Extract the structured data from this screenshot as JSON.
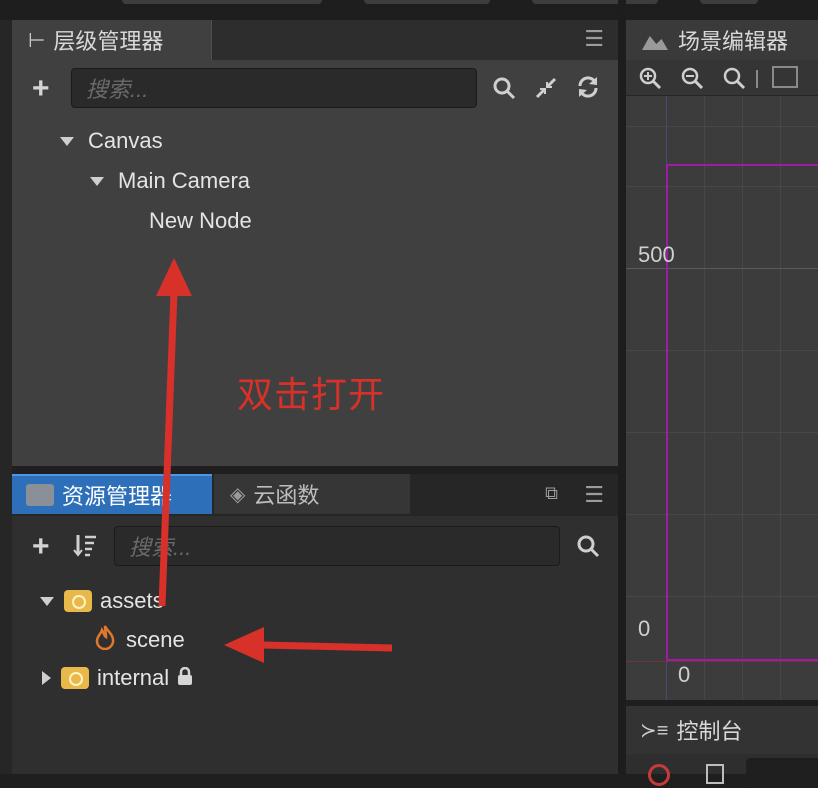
{
  "hierarchy": {
    "tab_label": "层级管理器",
    "search_placeholder": "搜索...",
    "tree": [
      {
        "label": "Canvas"
      },
      {
        "label": "Main Camera"
      },
      {
        "label": "New Node"
      }
    ]
  },
  "assets": {
    "tab_label": "资源管理器",
    "cloud_tab_label": "云函数",
    "search_placeholder": "搜索...",
    "tree": [
      {
        "label": "assets"
      },
      {
        "label": "scene"
      },
      {
        "label": "internal"
      }
    ]
  },
  "scene_editor": {
    "tab_label": "场景编辑器",
    "axis_labels": {
      "y_500": "500",
      "y_0": "0",
      "x_0": "0"
    }
  },
  "console": {
    "tab_label": "控制台"
  },
  "annotation": {
    "text": "双击打开"
  },
  "colors": {
    "accent": "#2d6fb8",
    "annotation": "#d8312a",
    "canvas_border": "#a01aa8",
    "folder": "#e8b94a"
  },
  "icons": [
    "hierarchy-icon",
    "menu-icon",
    "plus-icon",
    "search-icon",
    "collapse-icon",
    "refresh-icon",
    "folder-icon",
    "cloud-icon",
    "popout-icon",
    "sort-icon",
    "flame-icon",
    "lock-icon",
    "scene-icon",
    "zoom-in-icon",
    "zoom-out-icon",
    "zoom-reset-icon",
    "console-icon"
  ]
}
